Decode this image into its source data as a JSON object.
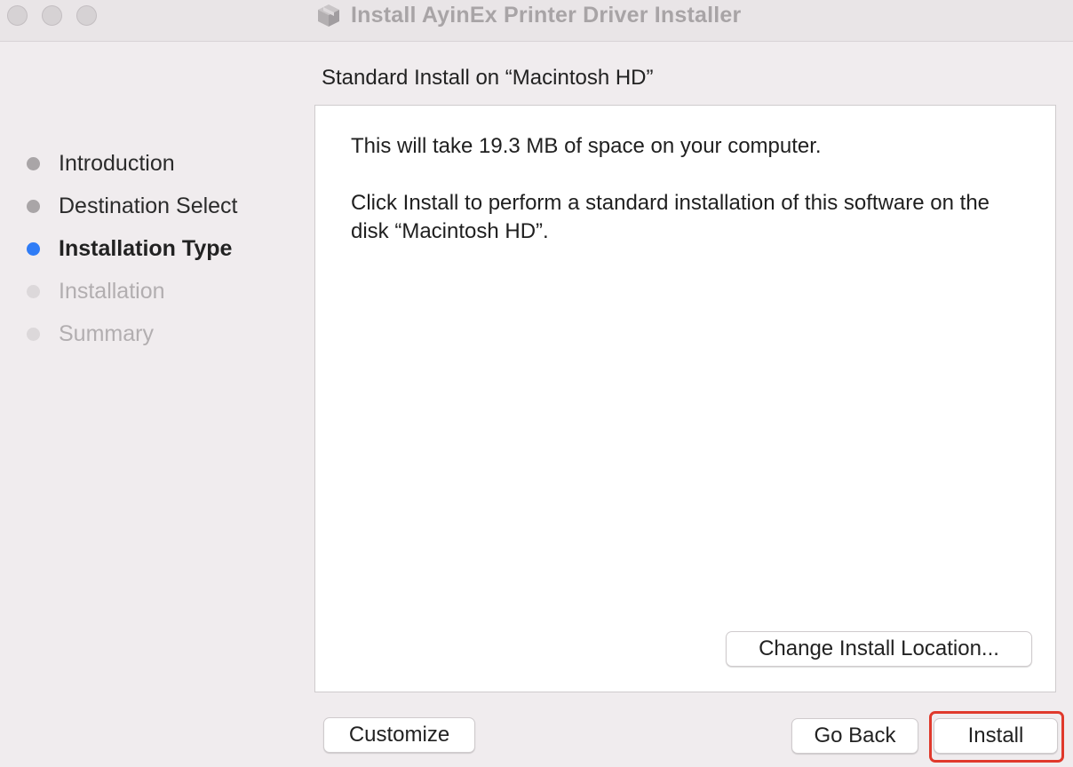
{
  "window": {
    "title": "Install AyinEx Printer Driver Installer",
    "icon": "package-icon"
  },
  "sidebar": {
    "steps": [
      {
        "label": "Introduction",
        "state": "done"
      },
      {
        "label": "Destination Select",
        "state": "done"
      },
      {
        "label": "Installation Type",
        "state": "current"
      },
      {
        "label": "Installation",
        "state": "future"
      },
      {
        "label": "Summary",
        "state": "future"
      }
    ]
  },
  "main": {
    "heading": "Standard Install on “Macintosh HD”",
    "paragraphs": [
      "This will take 19.3 MB of space on your computer.",
      "Click Install to perform a standard installation of this software on the disk “Macintosh HD”."
    ],
    "change_location_label": "Change Install Location..."
  },
  "footer": {
    "customize_label": "Customize",
    "go_back_label": "Go Back",
    "install_label": "Install"
  },
  "colors": {
    "accent": "#2f7cf6",
    "highlight": "#e0392c"
  }
}
